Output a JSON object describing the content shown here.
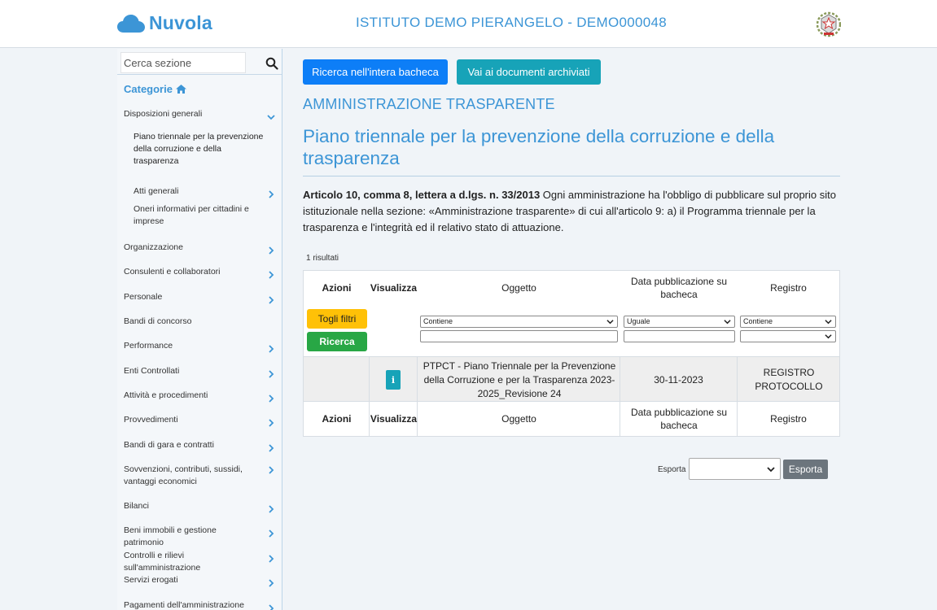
{
  "header": {
    "app_name": "Nuvola",
    "school_title": "ISTITUTO DEMO PIERANGELO - DEMO000048",
    "logo_icon": "cloud-icon",
    "emblem_icon": "italian-republic-emblem-icon"
  },
  "sidebar": {
    "search_placeholder": "Cerca sezione",
    "categories_label": "Categorie",
    "items": [
      {
        "label": "Disposizioni generali",
        "level": 0,
        "chevron": "down"
      },
      {
        "label": "Piano triennale per la prevenzione della corruzione e della trasparenza",
        "level": 1,
        "chevron": "none"
      },
      {
        "label": "Atti generali",
        "level": 1,
        "chevron": "right"
      },
      {
        "label": "Oneri informativi per cittadini e imprese",
        "level": 1,
        "chevron": "none"
      },
      {
        "label": "Organizzazione",
        "level": 0,
        "chevron": "right"
      },
      {
        "label": "Consulenti e collaboratori",
        "level": 0,
        "chevron": "right"
      },
      {
        "label": "Personale",
        "level": 0,
        "chevron": "right"
      },
      {
        "label": "Bandi di concorso",
        "level": 0,
        "chevron": "none"
      },
      {
        "label": "Performance",
        "level": 0,
        "chevron": "right"
      },
      {
        "label": "Enti Controllati",
        "level": 0,
        "chevron": "right"
      },
      {
        "label": "Attività e procedimenti",
        "level": 0,
        "chevron": "right"
      },
      {
        "label": "Provvedimenti",
        "level": 0,
        "chevron": "right"
      },
      {
        "label": "Bandi di gara e contratti",
        "level": 0,
        "chevron": "right"
      },
      {
        "label": "Sovvenzioni, contributi, sussidi, vantaggi economici",
        "level": 0,
        "chevron": "right"
      },
      {
        "label": "Bilanci",
        "level": 0,
        "chevron": "right"
      },
      {
        "label": "Beni immobili e gestione patrimonio",
        "level": 0,
        "chevron": "right"
      },
      {
        "label": "Controlli e rilievi sull'amministrazione",
        "level": 0,
        "chevron": "right"
      },
      {
        "label": "Servizi erogati",
        "level": 0,
        "chevron": "right"
      },
      {
        "label": "Pagamenti dell'amministrazione",
        "level": 0,
        "chevron": "right"
      }
    ]
  },
  "main": {
    "search_all_button": "Ricerca nell'intera bacheca",
    "archived_button": "Vai ai documenti archiviati",
    "section_title": "AMMINISTRAZIONE TRASPARENTE",
    "page_title": "Piano triennale per la prevenzione della corruzione e della trasparenza",
    "description_bold": "Articolo 10, comma 8, lettera a d.lgs. n. 33/2013",
    "description_text": " Ogni amministrazione ha l'obbligo di pubblicare sul proprio sito istituzionale nella sezione: «Amministrazione trasparente» di cui all'articolo 9: a) il Programma triennale per la trasparenza e l'integrità ed il relativo stato di attuazione.",
    "result_count": "1 risultati"
  },
  "table": {
    "headers": [
      "Azioni",
      "Visualizza",
      "Oggetto",
      "Data pubblicazione su bacheca",
      "Registro"
    ],
    "toggle_filters_button": "Togli filtri",
    "search_button": "Ricerca",
    "filters": {
      "oggetto_mode": "Contiene",
      "data_mode": "Uguale",
      "registro_mode": "Contiene"
    },
    "rows": [
      {
        "oggetto": "PTPCT - Piano Triennale per la Prevenzione della Corruzione e per la Trasparenza 2023-2025_Revisione 24",
        "data": "30-11-2023",
        "registro": "REGISTRO PROTOCOLLO",
        "info_icon": "info-icon"
      }
    ]
  },
  "export": {
    "label": "Esporta",
    "button": "Esporta",
    "selected": ""
  }
}
